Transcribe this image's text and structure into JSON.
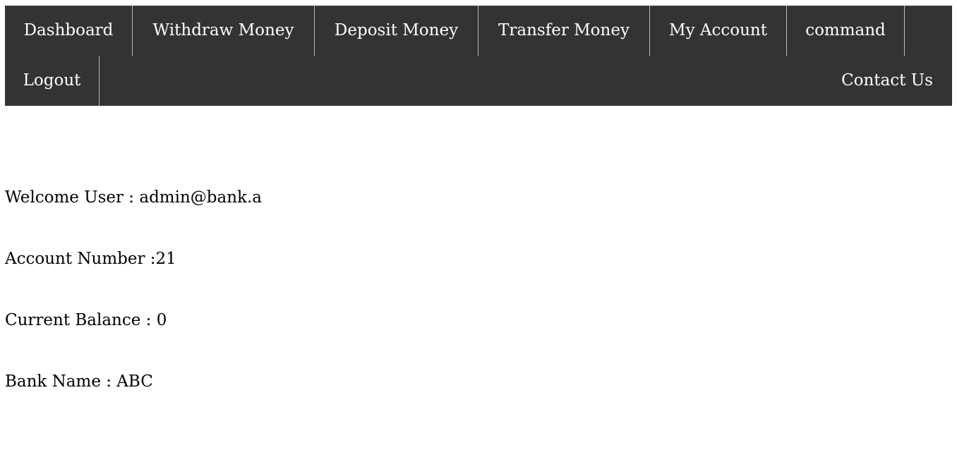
{
  "nav": {
    "dashboard": "Dashboard",
    "withdraw": "Withdraw Money",
    "deposit": "Deposit Money",
    "transfer": "Transfer Money",
    "my_account": "My Account",
    "command": "command",
    "logout": "Logout",
    "contact": "Contact Us"
  },
  "colors": {
    "navbar_bg": "#333333",
    "nav_text": "#ffffff",
    "separator": "#bbbbbb"
  },
  "account": {
    "welcome": "Welcome User : admin@bank.a",
    "account_number": "Account Number :21",
    "current_balance": "Current Balance : 0",
    "bank_name": "Bank Name : ABC"
  }
}
